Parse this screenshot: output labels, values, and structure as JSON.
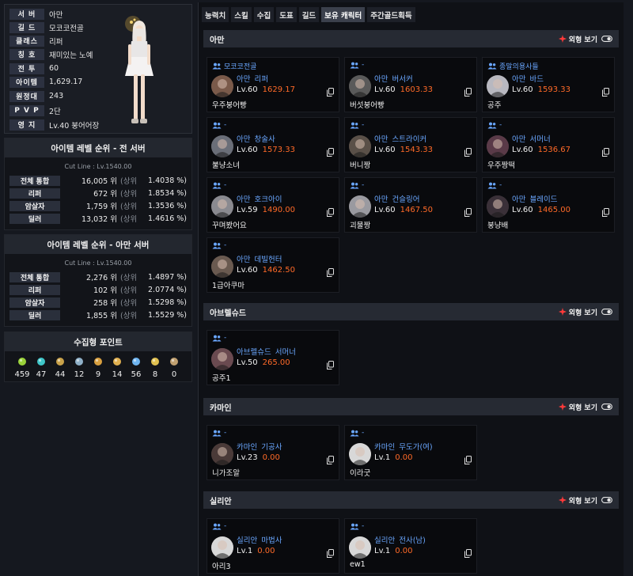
{
  "profile": {
    "rows": [
      {
        "label": "서 버",
        "value": "아만"
      },
      {
        "label": "길 드",
        "value": "모코코전골"
      },
      {
        "label": "클래스",
        "value": "리퍼"
      },
      {
        "label": "칭 호",
        "value": "재미있는 노예"
      },
      {
        "label": "전 투",
        "value": "60"
      },
      {
        "label": "아이템",
        "value": "1,629.17"
      },
      {
        "label": "원정대",
        "value": "243"
      },
      {
        "label": "P V P",
        "value": "2단"
      },
      {
        "label": "영 지",
        "value": "Lv.40 붕어어장"
      }
    ]
  },
  "rank_all": {
    "title": "아이템 레벨 순위 - 전 서버",
    "cutline": "Cut Line : Lv.1540.00",
    "rows": [
      {
        "label": "전체 통합",
        "rank": "16,005 위",
        "sub": "(상위",
        "pct": "1.4038 %)"
      },
      {
        "label": "리퍼",
        "rank": "672 위",
        "sub": "(상위",
        "pct": "1.8534 %)"
      },
      {
        "label": "암살자",
        "rank": "1,759 위",
        "sub": "(상위",
        "pct": "1.3536 %)"
      },
      {
        "label": "딜러",
        "rank": "13,032 위",
        "sub": "(상위",
        "pct": "1.4616 %)"
      }
    ]
  },
  "rank_server": {
    "title": "아이템 레벨 순위 - 아만 서버",
    "cutline": "Cut Line : Lv.1540.00",
    "rows": [
      {
        "label": "전체 통합",
        "rank": "2,276 위",
        "sub": "(상위",
        "pct": "1.4897 %)"
      },
      {
        "label": "리퍼",
        "rank": "102 위",
        "sub": "(상위",
        "pct": "2.0774 %)"
      },
      {
        "label": "암살자",
        "rank": "258 위",
        "sub": "(상위",
        "pct": "1.5298 %)"
      },
      {
        "label": "딜러",
        "rank": "1,855 위",
        "sub": "(상위",
        "pct": "1.5529 %)"
      }
    ]
  },
  "collect": {
    "title": "수집형 포인트",
    "items": [
      {
        "icon": "mokoko-seed-icon",
        "value": "459",
        "color": "#9ad23a"
      },
      {
        "icon": "island-heart-icon",
        "value": "47",
        "color": "#3fc6c9"
      },
      {
        "icon": "great-art-icon",
        "value": "44",
        "color": "#c9a24a"
      },
      {
        "icon": "giant-heart-icon",
        "value": "12",
        "color": "#8fb0c8"
      },
      {
        "icon": "ignea-token-icon",
        "value": "9",
        "color": "#d9a040"
      },
      {
        "icon": "adventure-book-icon",
        "value": "14",
        "color": "#e0b050"
      },
      {
        "icon": "sea-bounty-icon",
        "value": "56",
        "color": "#6fb5f0"
      },
      {
        "icon": "world-tree-leaf-icon",
        "value": "8",
        "color": "#e0c050"
      },
      {
        "icon": "orpheus-star-icon",
        "value": "0",
        "color": "#c0a070"
      }
    ]
  },
  "tabs": [
    "능력치",
    "스킬",
    "수집",
    "도표",
    "길드",
    "보유 캐릭터",
    "주간골드획득"
  ],
  "look_label": "외형 보기",
  "servers": [
    {
      "name": "아만",
      "chars": [
        {
          "guild": "모코코전골",
          "server": "아만",
          "class": "리퍼",
          "lv": "Lv.60",
          "item": "1629.17",
          "name": "우주붕어빵",
          "portrait": "#7a5a4a"
        },
        {
          "guild": "-",
          "server": "아만",
          "class": "버서커",
          "lv": "Lv.60",
          "item": "1603.33",
          "name": "버섯붕어빵",
          "portrait": "#5a5a5a"
        },
        {
          "guild": "종말의용사들",
          "server": "아만",
          "class": "바드",
          "lv": "Lv.60",
          "item": "1593.33",
          "name": "공주",
          "portrait": "#b8b8c0"
        },
        {
          "guild": "-",
          "server": "아만",
          "class": "창술사",
          "lv": "Lv.60",
          "item": "1573.33",
          "name": "불냥소녀",
          "portrait": "#6a6e78"
        },
        {
          "guild": "-",
          "server": "아만",
          "class": "스트라이커",
          "lv": "Lv.60",
          "item": "1543.33",
          "name": "버니짱",
          "portrait": "#5a5048"
        },
        {
          "guild": "-",
          "server": "아만",
          "class": "서머너",
          "lv": "Lv.60",
          "item": "1536.67",
          "name": "우주짱떡",
          "portrait": "#5a3a48"
        },
        {
          "guild": "-",
          "server": "아만",
          "class": "호크아이",
          "lv": "Lv.59",
          "item": "1490.00",
          "name": "꾸며봤어요",
          "portrait": "#8a8a90"
        },
        {
          "guild": "-",
          "server": "아만",
          "class": "건슬링어",
          "lv": "Lv.60",
          "item": "1467.50",
          "name": "괴물짱",
          "portrait": "#9a9aa0"
        },
        {
          "guild": "-",
          "server": "아만",
          "class": "블레이드",
          "lv": "Lv.60",
          "item": "1465.00",
          "name": "붕냥배",
          "portrait": "#3a3038"
        },
        {
          "guild": "-",
          "server": "아만",
          "class": "데빌헌터",
          "lv": "Lv.60",
          "item": "1462.50",
          "name": "1급아쿠마",
          "portrait": "#6a5a50"
        }
      ]
    },
    {
      "name": "아브렐슈드",
      "chars": [
        {
          "guild": "-",
          "server": "아브렐슈드",
          "class": "서머너",
          "lv": "Lv.50",
          "item": "265.00",
          "name": "공주1",
          "portrait": "#6a4a50"
        }
      ]
    },
    {
      "name": "카마인",
      "chars": [
        {
          "guild": "-",
          "server": "카마인",
          "class": "기공사",
          "lv": "Lv.23",
          "item": "0.00",
          "name": "니가조알",
          "portrait": "#4a3a38"
        },
        {
          "guild": "-",
          "server": "카마인",
          "class": "무도가(여)",
          "lv": "Lv.1",
          "item": "0.00",
          "name": "이라굿",
          "portrait": "#d8d8d8"
        }
      ]
    },
    {
      "name": "실리안",
      "chars": [
        {
          "guild": "-",
          "server": "실리안",
          "class": "마법사",
          "lv": "Lv.1",
          "item": "0.00",
          "name": "아리3",
          "portrait": "#d8d8d8"
        },
        {
          "guild": "-",
          "server": "실리안",
          "class": "전사(남)",
          "lv": "Lv.1",
          "item": "0.00",
          "name": "ew1",
          "portrait": "#d8d8d8"
        }
      ]
    }
  ]
}
